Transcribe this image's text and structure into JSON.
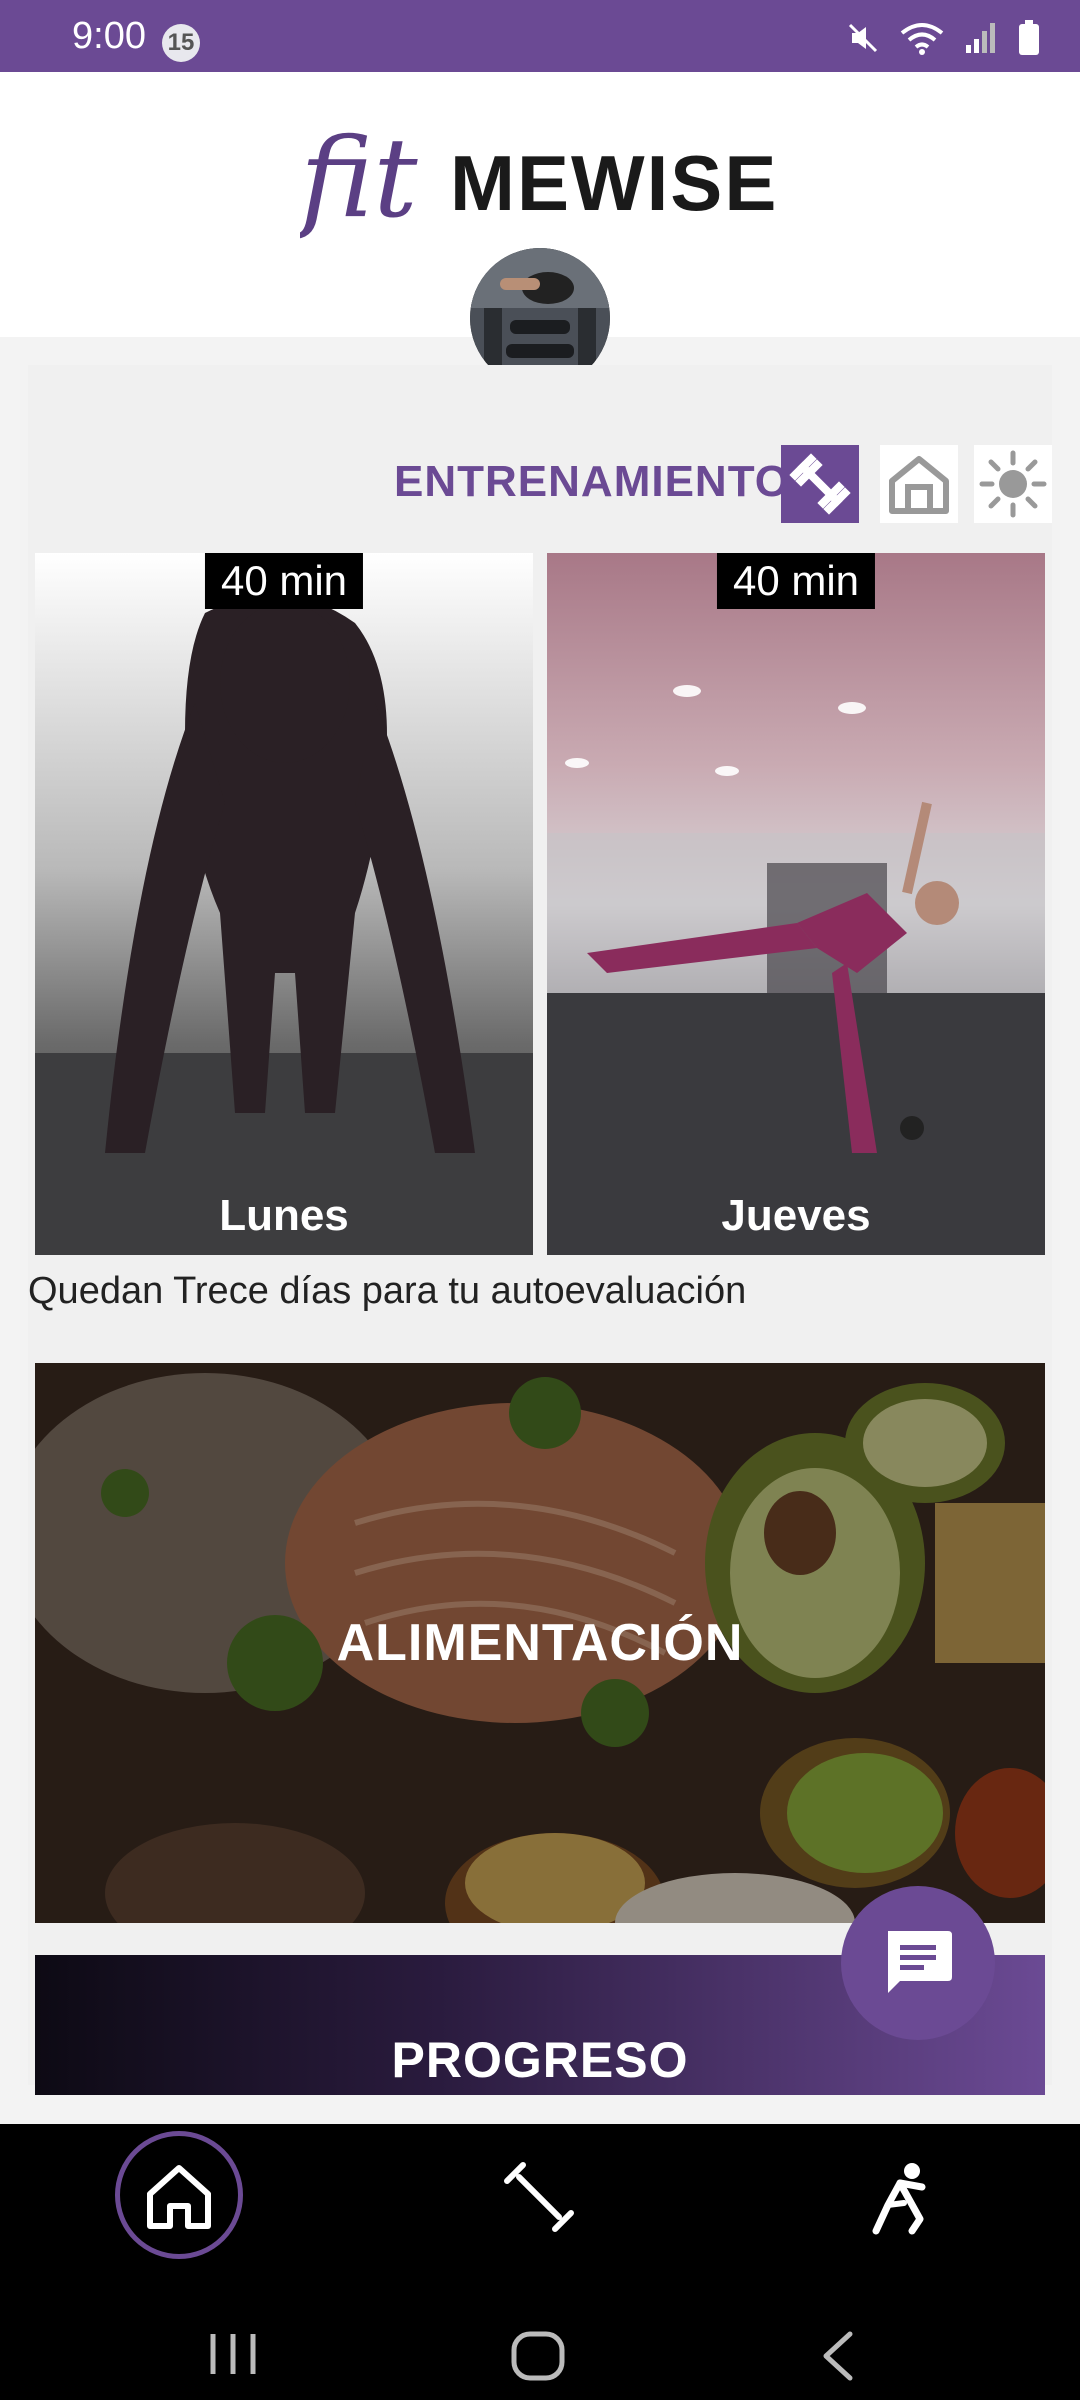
{
  "status_bar": {
    "time": "9:00",
    "notification_count": "15",
    "icons": [
      "mute-icon",
      "wifi-icon",
      "signal-icon",
      "battery-icon"
    ]
  },
  "header": {
    "logo_script": "fit",
    "logo_word": "MEWISE"
  },
  "training": {
    "title": "ENTRENAMIENTO",
    "modes": [
      {
        "name": "gym-mode",
        "icon": "dumbbell-icon",
        "active": true
      },
      {
        "name": "home-mode",
        "icon": "house-icon",
        "active": false
      },
      {
        "name": "outdoor-mode",
        "icon": "sun-icon",
        "active": false
      }
    ],
    "cards": [
      {
        "duration": "40 min",
        "day": "Lunes"
      },
      {
        "duration": "40 min",
        "day": "Jueves"
      }
    ],
    "countdown": "Quedan Trece días para tu autoevaluación"
  },
  "nutrition": {
    "label": "ALIMENTACIÓN"
  },
  "progress": {
    "label": "PROGRESO"
  },
  "bottom_nav": {
    "items": [
      {
        "name": "home",
        "icon": "home-icon",
        "active": true
      },
      {
        "name": "workouts",
        "icon": "dumbbell-icon",
        "active": false
      },
      {
        "name": "stretching",
        "icon": "stretching-icon",
        "active": false
      }
    ]
  },
  "colors": {
    "brand": "#6b4a94",
    "status_bar": "#6b4a94",
    "background": "#f3f3f3",
    "nav_bar": "#000000"
  }
}
